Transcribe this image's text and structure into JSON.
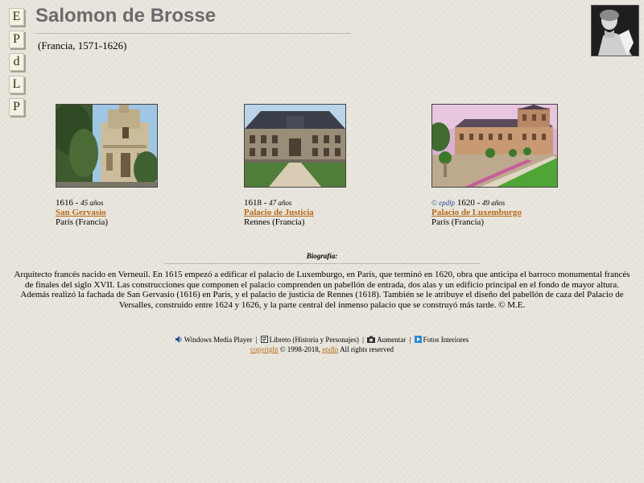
{
  "side_nav": [
    "E",
    "P",
    "d",
    "L",
    "P"
  ],
  "title": "Salomon de Brosse",
  "subtitle": "(Francia, 1571-1626)",
  "works": [
    {
      "copyright_tag": "",
      "year": "1616",
      "separator": " - ",
      "age": "45 años",
      "name": "San Gervasio",
      "place": "París (Francia)"
    },
    {
      "copyright_tag": "",
      "year": "1618",
      "separator": " - ",
      "age": "47 años",
      "name": "Palacio de Justicia",
      "place": "Rennes (Francia)"
    },
    {
      "copyright_tag": "© epdlp",
      "year": "1620",
      "separator": " - ",
      "age": "49 años",
      "name": "Palacio de Luxemburgo",
      "place": "París (Francia)"
    }
  ],
  "bio": {
    "heading": "Biografía:",
    "text": "Arquitecto francés nacido en Verneuil. En 1615 empezó a edificar el palacio de Luxemburgo, en París, que terminó en 1620, obra que anticipa el barroco monumental francés de finales del siglo XVII. Las construcciones que componen el palacio comprenden un pabellón de entrada, dos alas y un edificio principal en el fondo de mayor altura. Además realizó la fachada de San Gervasio (1616) en París, y el palacio de justicia de Rennes (1618). También se le atribuye el diseño del pabellón de caza del Palacio de Versalles, construido entre 1624 y 1626, y la parte central del inmenso palacio que se construyó más tarde. © M.E."
  },
  "footer": {
    "links": [
      {
        "icon": "speaker-icon",
        "label": "Windows Media Player"
      },
      {
        "icon": "book-icon",
        "label": "Libreto (Historia y Personajes)"
      },
      {
        "icon": "camera-icon",
        "label": "Aumentar"
      },
      {
        "icon": "play-icon",
        "label": "Fotos Interiores"
      }
    ],
    "separator": "|",
    "copyright_link": "copyright",
    "copyright_years": "© 1998-2018,",
    "site_link": "epdlp",
    "rights": "All rights reserved"
  },
  "colors": {
    "title": "#6b6b6b",
    "link": "#b86a12",
    "copyright_tag": "#2e4c9a",
    "background": "#ebe8df"
  }
}
